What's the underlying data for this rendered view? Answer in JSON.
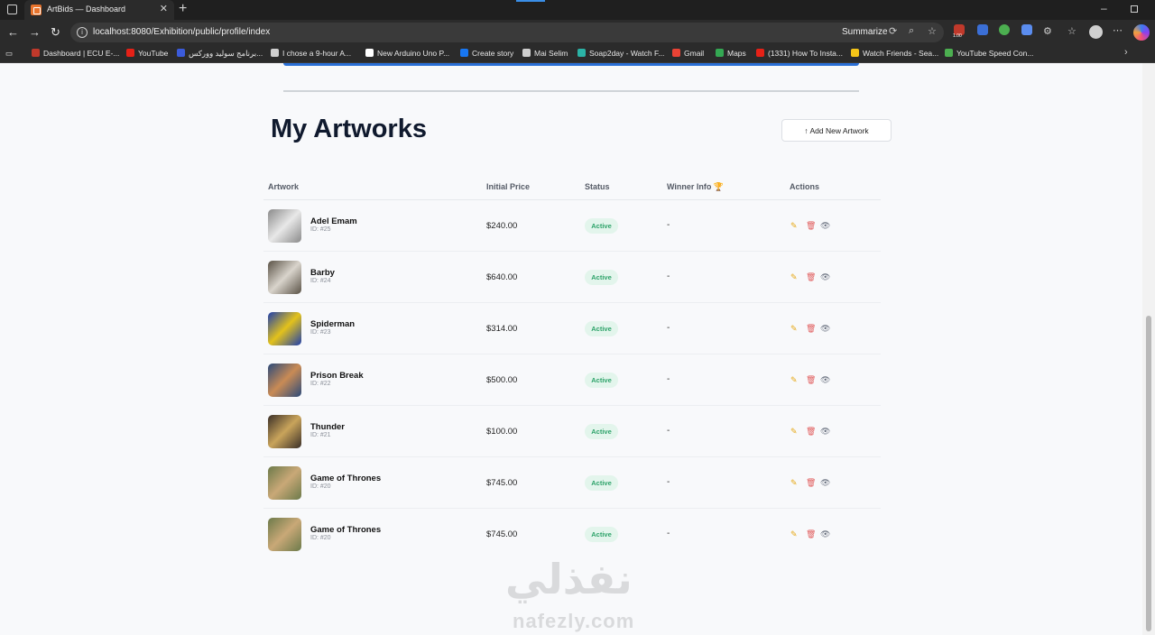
{
  "browser": {
    "tab_title": "ArtBids — Dashboard",
    "tab_close": "✕",
    "new_tab": "+",
    "url": "localhost:8080/Exhibition/public/profile/index",
    "summarize": "Summarize",
    "badge": "1.00",
    "window_min": "–"
  },
  "bookmarks": [
    {
      "label": "Dashboard | ECU E-...",
      "color": "#c0392b"
    },
    {
      "label": "YouTube",
      "color": "#e62117"
    },
    {
      "label": "برنامج سوليد ووركس...",
      "color": "#3b5bdb"
    },
    {
      "label": "I chose a 9-hour A...",
      "color": "#cfcfcf"
    },
    {
      "label": "New Arduino Uno P...",
      "color": "#ffffff"
    },
    {
      "label": "Create story",
      "color": "#1877f2"
    },
    {
      "label": "Mai Selim",
      "color": "#cfcfcf"
    },
    {
      "label": "Soap2day - Watch F...",
      "color": "#2bb3a6"
    },
    {
      "label": "Gmail",
      "color": "#ea4335"
    },
    {
      "label": "Maps",
      "color": "#34a853"
    },
    {
      "label": "(1331) How To Insta...",
      "color": "#e62117"
    },
    {
      "label": "Watch Friends - Sea...",
      "color": "#f5c518"
    },
    {
      "label": "YouTube Speed Con...",
      "color": "#4caf50"
    }
  ],
  "page": {
    "title": "My Artworks",
    "add_button": "↑ Add New Artwork",
    "columns": {
      "artwork": "Artwork",
      "price": "Initial Price",
      "status": "Status",
      "winner": "Winner Info 🏆",
      "actions": "Actions"
    },
    "rows": [
      {
        "name": "Adel Emam",
        "id": "ID: #25",
        "price": "$240.00",
        "status": "Active",
        "winner": "-",
        "thumb": [
          "#8a8a8a",
          "#e8e8e8"
        ]
      },
      {
        "name": "Barby",
        "id": "ID: #24",
        "price": "$640.00",
        "status": "Active",
        "winner": "-",
        "thumb": [
          "#5a5246",
          "#d9d4cc"
        ]
      },
      {
        "name": "Spiderman",
        "id": "ID: #23",
        "price": "$314.00",
        "status": "Active",
        "winner": "-",
        "thumb": [
          "#1e3fae",
          "#e3c21b"
        ]
      },
      {
        "name": "Prison Break",
        "id": "ID: #22",
        "price": "$500.00",
        "status": "Active",
        "winner": "-",
        "thumb": [
          "#2b4a7a",
          "#c98b55"
        ]
      },
      {
        "name": "Thunder",
        "id": "ID: #21",
        "price": "$100.00",
        "status": "Active",
        "winner": "-",
        "thumb": [
          "#3a2f28",
          "#c9a45b"
        ]
      },
      {
        "name": "Game of Thrones",
        "id": "ID: #20",
        "price": "$745.00",
        "status": "Active",
        "winner": "-",
        "thumb": [
          "#6c7a4a",
          "#c9a877"
        ]
      },
      {
        "name": "Game of Thrones",
        "id": "ID: #20",
        "price": "$745.00",
        "status": "Active",
        "winner": "-",
        "thumb": [
          "#6c7a4a",
          "#c9a877"
        ]
      }
    ],
    "actions": {
      "edit": "✎",
      "delete": "🗑",
      "view": "👁"
    }
  },
  "watermark": {
    "arabic": "نفذلي",
    "latin": "nafezly.com"
  }
}
